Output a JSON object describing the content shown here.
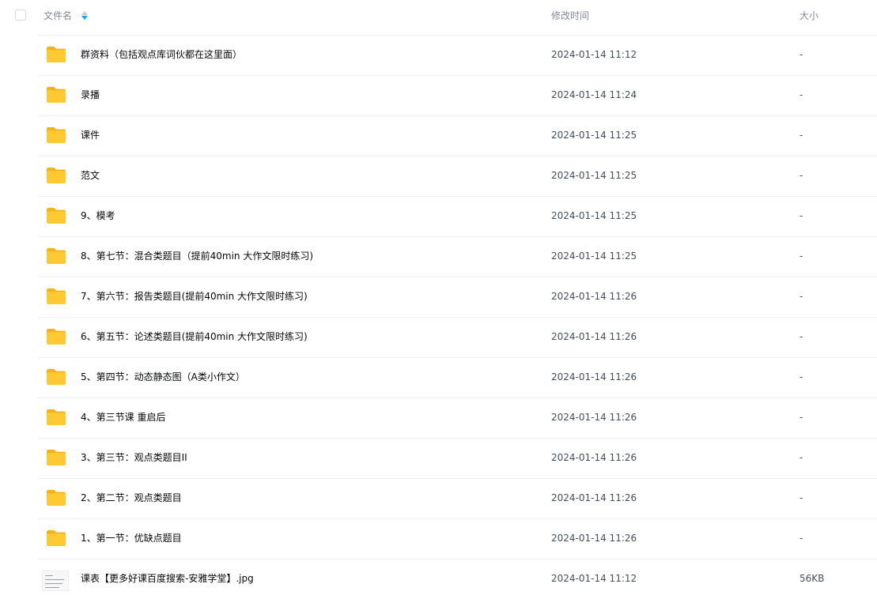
{
  "header": {
    "name_label": "文件名",
    "time_label": "修改时间",
    "size_label": "大小"
  },
  "files": [
    {
      "name": "群资料（包括观点库词伙都在这里面）",
      "time": "2024-01-14 11:12",
      "size": "-",
      "type": "folder"
    },
    {
      "name": "录播",
      "time": "2024-01-14 11:24",
      "size": "-",
      "type": "folder"
    },
    {
      "name": "课件",
      "time": "2024-01-14 11:25",
      "size": "-",
      "type": "folder"
    },
    {
      "name": "范文",
      "time": "2024-01-14 11:25",
      "size": "-",
      "type": "folder"
    },
    {
      "name": "9、模考",
      "time": "2024-01-14 11:25",
      "size": "-",
      "type": "folder"
    },
    {
      "name": "8、第七节：混合类题目（提前40min 大作文限时练习)",
      "time": "2024-01-14 11:25",
      "size": "-",
      "type": "folder"
    },
    {
      "name": "7、第六节：报告类题目(提前40min 大作文限时练习)",
      "time": "2024-01-14 11:26",
      "size": "-",
      "type": "folder"
    },
    {
      "name": "6、第五节：论述类题目(提前40min 大作文限时练习)",
      "time": "2024-01-14 11:26",
      "size": "-",
      "type": "folder"
    },
    {
      "name": "5、第四节：动态静态图（A类小作文）",
      "time": "2024-01-14 11:26",
      "size": "-",
      "type": "folder"
    },
    {
      "name": "4、第三节课 重启后",
      "time": "2024-01-14 11:26",
      "size": "-",
      "type": "folder"
    },
    {
      "name": "3、第三节：观点类题目II",
      "time": "2024-01-14 11:26",
      "size": "-",
      "type": "folder"
    },
    {
      "name": "2、第二节：观点类题目",
      "time": "2024-01-14 11:26",
      "size": "-",
      "type": "folder"
    },
    {
      "name": "1、第一节：优缺点题目",
      "time": "2024-01-14 11:26",
      "size": "-",
      "type": "folder"
    },
    {
      "name": "课表【更多好课百度搜索-安雅学堂】.jpg",
      "time": "2024-01-14 11:12",
      "size": "56KB",
      "type": "image"
    }
  ],
  "colors": {
    "folder": "#FFC933",
    "folder_back": "#F5B21B",
    "sort_active": "#06a7ff",
    "header_text": "#818999"
  }
}
